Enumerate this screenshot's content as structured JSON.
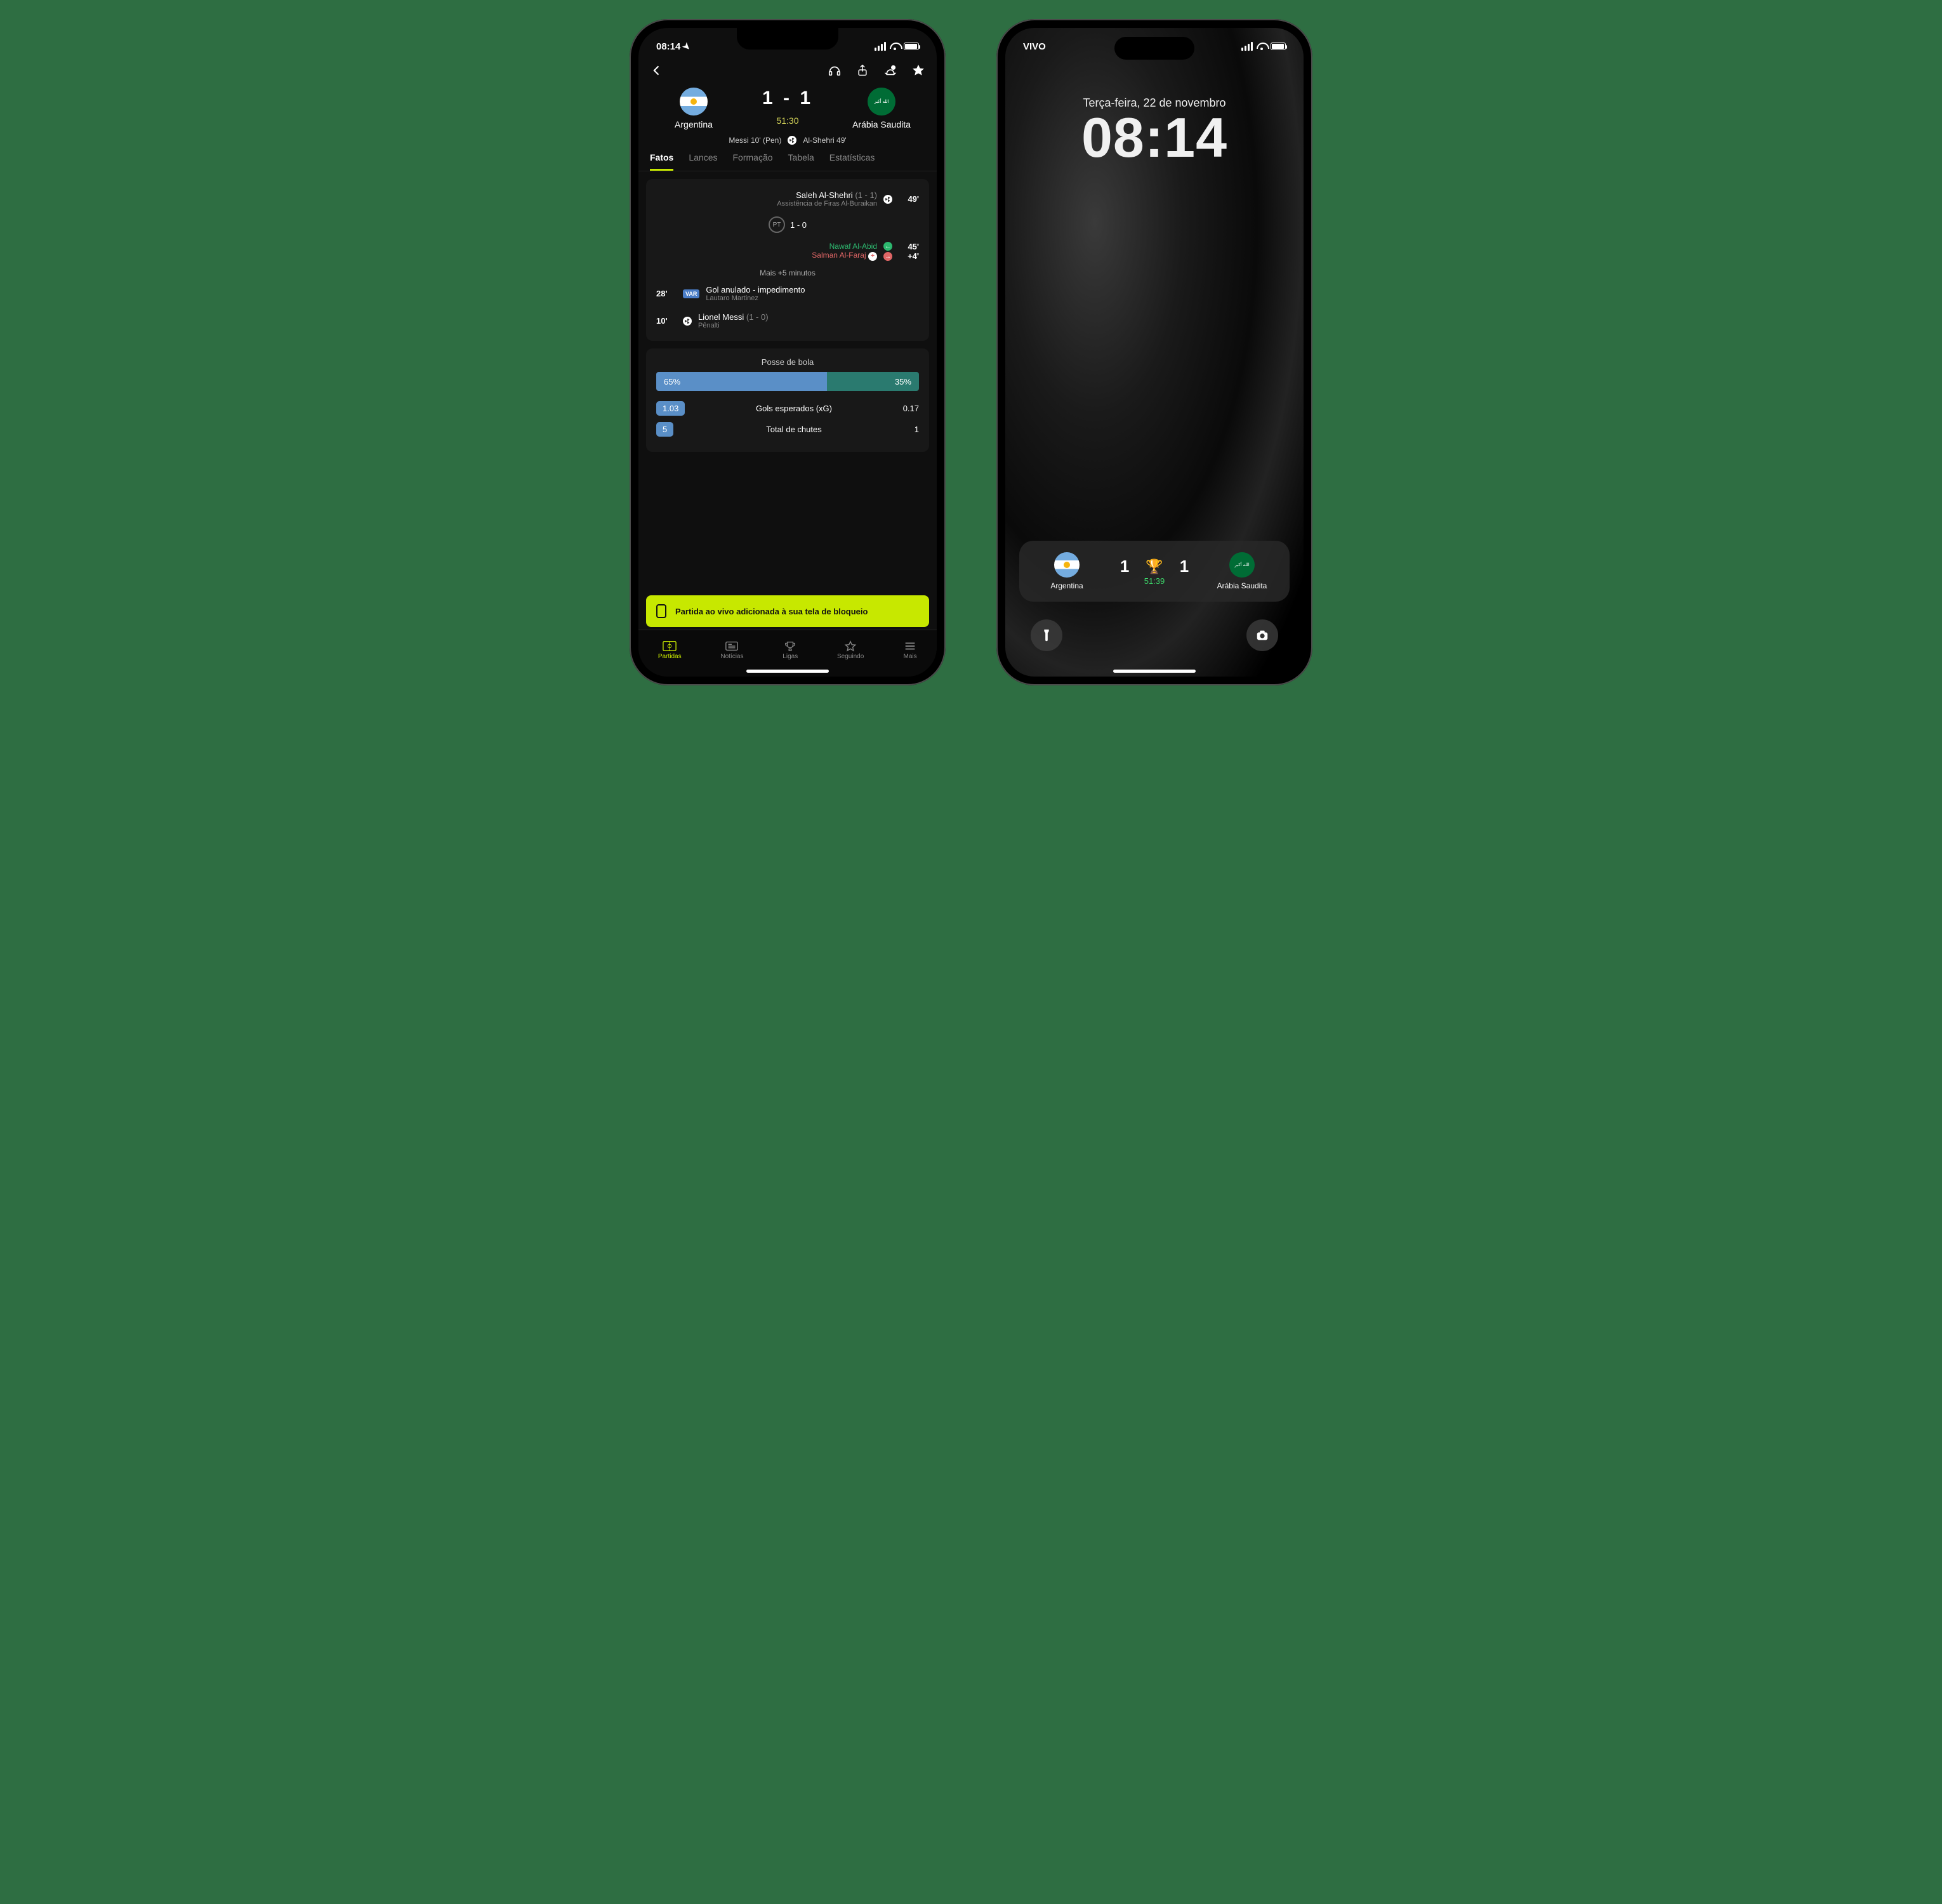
{
  "phone1": {
    "status": {
      "time": "08:14"
    },
    "header": {
      "score": "1 - 1",
      "clock": "51:30",
      "home": {
        "name": "Argentina"
      },
      "away": {
        "name": "Arábia Saudita"
      },
      "scorers_left": "Messi 10' (Pen)",
      "scorers_right": "Al-Shehri 49'"
    },
    "tabs": [
      "Fatos",
      "Lances",
      "Formação",
      "Tabela",
      "Estatísticas"
    ],
    "events": {
      "goal_away": {
        "player": "Saleh Al-Shehri",
        "score": "(1 - 1)",
        "assist": "Assistência de Firas Al-Buraikan",
        "min": "49'"
      },
      "ht_label": "PT",
      "ht_score": "1 - 0",
      "sub_in": "Nawaf Al-Abid",
      "sub_out": "Salman Al-Faraj",
      "sub_in_min": "45'",
      "sub_out_min": "+4'",
      "extra": "Mais +5 minutos",
      "var": {
        "min": "28'",
        "title": "Gol anulado - impedimento",
        "player": "Lautaro Martinez"
      },
      "goal_home": {
        "min": "10'",
        "player": "Lionel Messi",
        "score": "(1 - 0)",
        "type": "Pênalti"
      }
    },
    "stats": {
      "poss_title": "Posse de bola",
      "poss_left": "65%",
      "poss_right": "35%",
      "poss_left_pct": 65,
      "xg_label": "Gols esperados (xG)",
      "xg_home": "1.03",
      "xg_away": "0.17",
      "shots_label": "Total de chutes",
      "shots_home": "5",
      "shots_away": "1"
    },
    "toast": "Partida ao vivo adicionada à sua tela de bloqueio",
    "tabbar": {
      "matches": "Partidas",
      "news": "Notícias",
      "leagues": "Ligas",
      "following": "Seguindo",
      "more": "Mais"
    }
  },
  "phone2": {
    "status": {
      "carrier": "VIVO"
    },
    "lock": {
      "date": "Terça-feira, 22 de novembro",
      "time": "08:14"
    },
    "widget": {
      "home_name": "Argentina",
      "away_name": "Arábia Saudita",
      "home_score": "1",
      "away_score": "1",
      "clock": "51:39"
    }
  },
  "chart_data": {
    "type": "bar",
    "title": "Posse de bola",
    "categories": [
      "Argentina",
      "Arábia Saudita"
    ],
    "values": [
      65,
      35
    ],
    "ylim": [
      0,
      100
    ]
  }
}
